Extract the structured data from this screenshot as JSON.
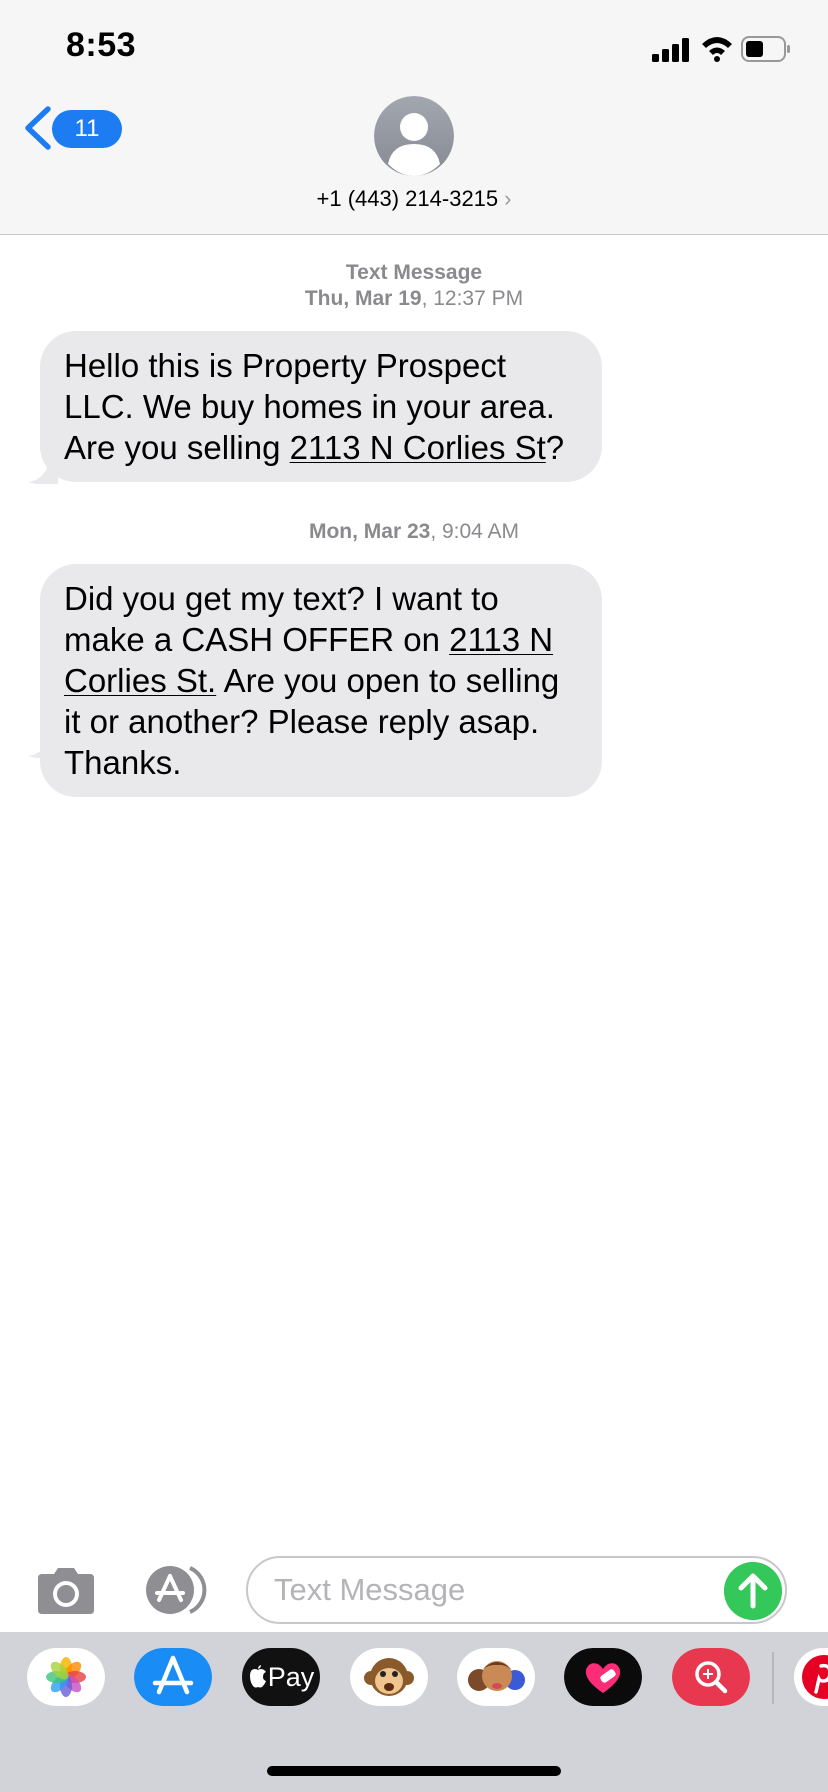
{
  "status_bar": {
    "time": "8:53"
  },
  "nav": {
    "back_badge": "11",
    "contact_name": "+1 (443) 214-3215",
    "contact_chevron": "›"
  },
  "messages": [
    {
      "timestamp_label": "Text Message",
      "timestamp_day": "Thu, Mar 19",
      "timestamp_time": ", 12:37 PM",
      "text_parts": [
        "Hello this is Property Prospect LLC. We buy homes in your area. Are you selling ",
        "2113 N Corlies St",
        "?"
      ]
    },
    {
      "timestamp_day": "Mon, Mar 23",
      "timestamp_time": ", 9:04 AM",
      "text_parts": [
        "Did you get my text? I want to make a CASH OFFER on ",
        "2113 N Corlies St.",
        " Are you open to selling it or another? Please reply asap. Thanks."
      ]
    }
  ],
  "input": {
    "placeholder": "Text Message"
  },
  "drawer": {
    "apple_pay_label": "Pay",
    "apps": [
      "photos-app-icon",
      "app-store-icon",
      "apple-pay-icon",
      "animoji-monkey-icon",
      "memoji-icon",
      "heart-sticker-icon",
      "web-search-icon",
      "pinterest-icon"
    ]
  },
  "colors": {
    "accent_blue": "#1e7cf2",
    "bubble_gray": "#e9e9eb",
    "send_green": "#34c759",
    "drawer_bg": "#d2d3d8"
  }
}
